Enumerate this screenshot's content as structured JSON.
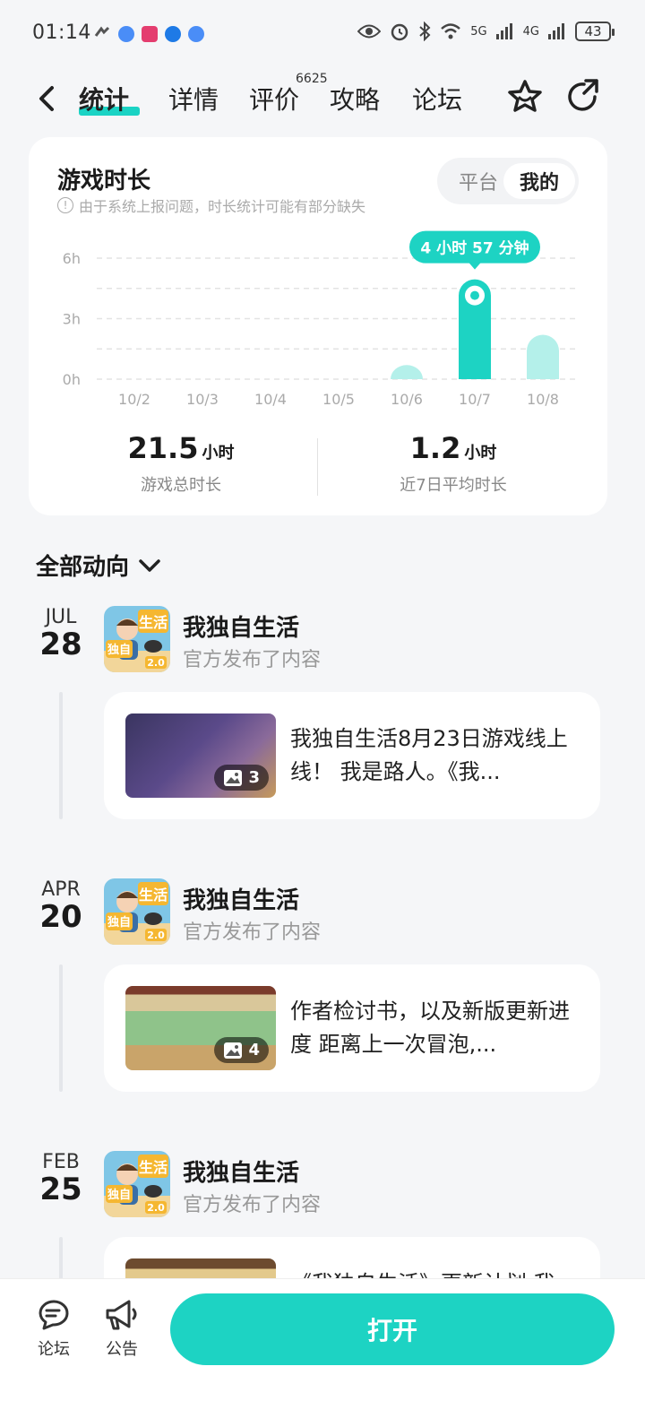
{
  "status_bar": {
    "time": "01:14",
    "battery": "43",
    "signal_1": "5G",
    "signal_2": "4G"
  },
  "nav": {
    "tabs": [
      {
        "label": "统计",
        "active": true
      },
      {
        "label": "详情"
      },
      {
        "label": "评价"
      },
      {
        "label": "攻略"
      },
      {
        "label": "论坛"
      }
    ],
    "review_count": "6625"
  },
  "stats_card": {
    "title": "游戏时长",
    "note": "由于系统上报问题，时长统计可能有部分缺失",
    "toggle": {
      "platform": "平台",
      "mine": "我的",
      "selected": "我的"
    },
    "tooltip": "4 小时 57 分钟",
    "accent_color": "#1dd3c3",
    "total": {
      "value": "21.5",
      "unit": "小时",
      "label": "游戏总时长"
    },
    "average": {
      "value": "1.2",
      "unit": "小时",
      "label": "近7日平均时长"
    }
  },
  "chart_data": {
    "type": "bar",
    "categories": [
      "10/2",
      "10/3",
      "10/4",
      "10/5",
      "10/6",
      "10/7",
      "10/8"
    ],
    "values": [
      0,
      0,
      0,
      0,
      0.7,
      4.95,
      2.2
    ],
    "highlight_index": 5,
    "yticks": [
      "0h",
      "3h",
      "6h"
    ],
    "ylim": [
      0,
      6
    ],
    "grid": true
  },
  "feed": {
    "header": "全部动向",
    "posts": [
      {
        "month": "JUL",
        "day": "28",
        "game": "我独自生活",
        "sub": "官方发布了内容",
        "text": "我独自生活8月23日游戏线上线！ 我是路人。《我...",
        "images": "3"
      },
      {
        "month": "APR",
        "day": "20",
        "game": "我独自生活",
        "sub": "官方发布了内容",
        "text": "作者检讨书，以及新版更新进度 距离上一次冒泡,...",
        "images": "4"
      },
      {
        "month": "FEB",
        "day": "25",
        "game": "我独自生活",
        "sub": "官方发布了内容",
        "text": "《我独自生活》更新计划 我...",
        "images": ""
      }
    ],
    "logo_text": "独自",
    "logo_text2": "生活",
    "logo_version": "2.0"
  },
  "bottom_bar": {
    "forum": "论坛",
    "notice": "公告",
    "open": "打开"
  }
}
